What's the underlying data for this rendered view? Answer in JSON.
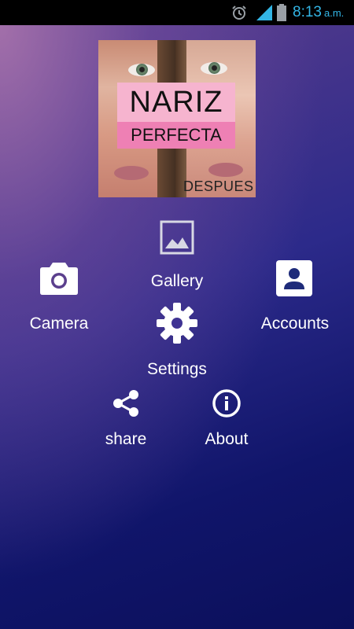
{
  "status_bar": {
    "time": "8:13",
    "ampm": "a.m.",
    "icons": [
      "alarm-icon",
      "signal-icon",
      "battery-icon"
    ],
    "accent_color": "#33b5e5"
  },
  "cover": {
    "title": "NARIZ",
    "subtitle": "PERFECTA",
    "after_label": "DESPUES"
  },
  "menu": {
    "gallery": {
      "label": "Gallery",
      "icon": "image-icon"
    },
    "camera": {
      "label": "Camera",
      "icon": "camera-icon"
    },
    "accounts": {
      "label": "Accounts",
      "icon": "account-box-icon"
    },
    "settings": {
      "label": "Settings",
      "icon": "gear-icon"
    },
    "share": {
      "label": "share",
      "icon": "share-icon"
    },
    "about": {
      "label": "About",
      "icon": "info-icon"
    }
  },
  "colors": {
    "background_top": "#5a3d8c",
    "background_bottom": "#0b0f5a",
    "title_box": "#f6b4cf",
    "subtitle_box": "#ee80b4"
  }
}
